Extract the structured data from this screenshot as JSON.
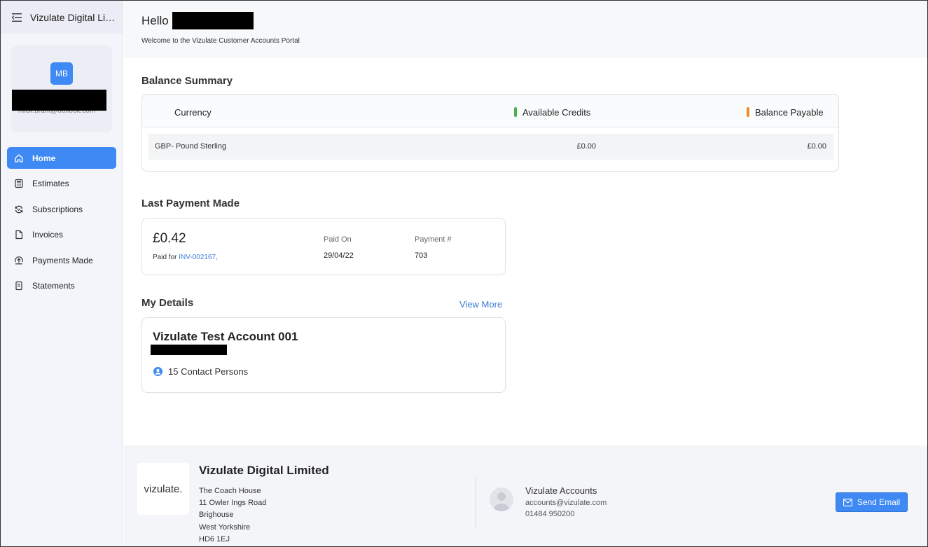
{
  "sidebar": {
    "org_name": "Vizulate Digital Limited",
    "user": {
      "initials": "MB",
      "email": "mick.brant@outlook.com"
    },
    "nav": [
      {
        "label": "Home",
        "icon": "home-icon",
        "active": true
      },
      {
        "label": "Estimates",
        "icon": "calculator-icon"
      },
      {
        "label": "Subscriptions",
        "icon": "refresh-icon"
      },
      {
        "label": "Invoices",
        "icon": "document-icon"
      },
      {
        "label": "Payments Made",
        "icon": "upload-circle-icon"
      },
      {
        "label": "Statements",
        "icon": "statement-icon"
      }
    ]
  },
  "header": {
    "greeting": "Hello",
    "welcome": "Welcome to the Vizulate Customer Accounts Portal"
  },
  "balance": {
    "title": "Balance Summary",
    "col_currency": "Currency",
    "col_credits": "Available Credits",
    "col_payable": "Balance Payable",
    "credits_color": "#4caf50",
    "payable_color": "#f28c28",
    "row": {
      "currency": "GBP- Pound Sterling",
      "credits": "£0.00",
      "payable": "£0.00"
    }
  },
  "last_payment": {
    "title": "Last Payment Made",
    "amount": "£0.42",
    "paid_for_label": "Paid for",
    "invoice": "INV-002167,",
    "paid_on_label": "Paid On",
    "paid_on": "29/04/22",
    "payment_no_label": "Payment #",
    "payment_no": "703"
  },
  "details": {
    "title": "My Details",
    "view_more": "View More",
    "account_name": "Vizulate Test Account 001",
    "contacts": "15 Contact Persons"
  },
  "footer": {
    "logo_text": "vizulate.",
    "company": "Vizulate Digital Limited",
    "address": [
      "The Coach House",
      "11 Owler Ings Road",
      "Brighouse",
      "West Yorkshire",
      "HD6 1EJ"
    ],
    "contact_name": "Vizulate Accounts",
    "contact_email": "accounts@vizulate.com",
    "contact_phone": "01484 950200",
    "send_email": "Send Email"
  },
  "colors": {
    "accent": "#3e89f3",
    "link": "#3a7bd5"
  }
}
